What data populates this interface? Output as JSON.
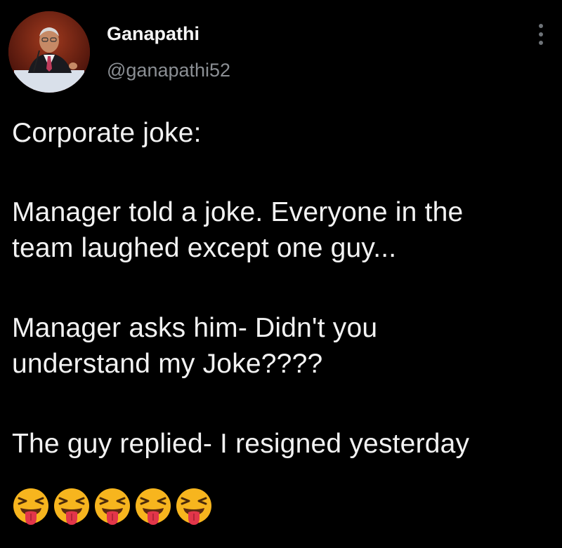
{
  "user": {
    "display_name": "Ganapathi",
    "handle": "@ganapathi52",
    "avatar_icon": "profile-photo"
  },
  "menu": {
    "icon": "more-vertical-icon"
  },
  "tweet": {
    "lines": [
      "Corporate joke:",
      "Manager told a joke. Everyone in the",
      "team laughed except one guy...",
      "Manager asks him- Didn't you",
      "understand my Joke????",
      "The guy replied- I resigned yesterday"
    ],
    "emojis": [
      "squinting-face-with-tongue",
      "squinting-face-with-tongue",
      "squinting-face-with-tongue",
      "squinting-face-with-tongue",
      "squinting-face-with-tongue"
    ]
  },
  "colors": {
    "background": "#000000",
    "text": "#f2f2f2",
    "handle": "#8b8f94",
    "emoji_face": "#f7b51e",
    "emoji_tongue": "#e2364a"
  }
}
